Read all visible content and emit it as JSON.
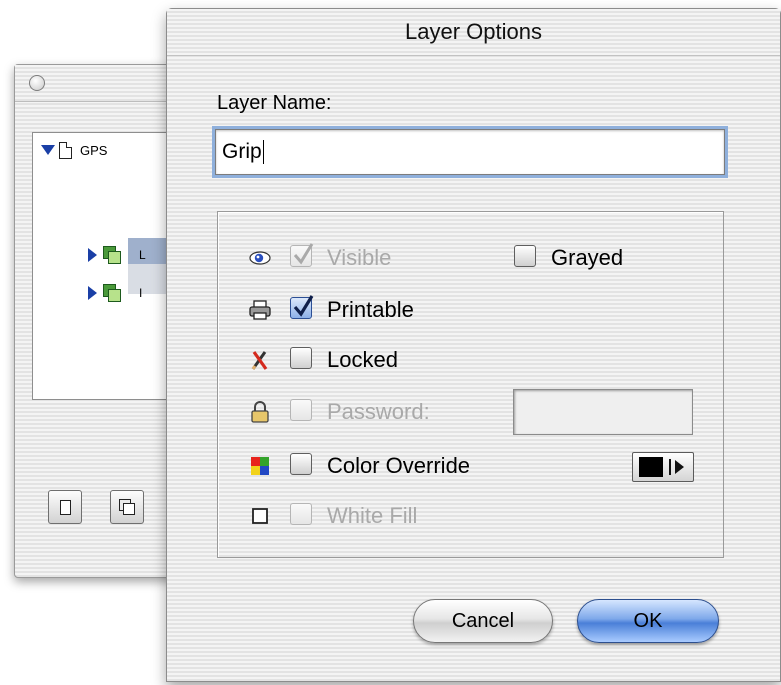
{
  "background_window": {
    "tree": {
      "root": {
        "label": "GPS",
        "expanded": true
      },
      "children": [
        {
          "label": "L",
          "expanded": false,
          "selected": true
        },
        {
          "label": "I",
          "expanded": false,
          "selected": false
        }
      ]
    },
    "buttons": [
      {
        "icon": "new-document-icon"
      },
      {
        "icon": "duplicate-layer-icon"
      }
    ]
  },
  "dialog": {
    "title": "Layer Options",
    "layer_name_label": "Layer Name:",
    "layer_name_value": "Grip",
    "options": {
      "visible": {
        "label": "Visible",
        "checked": true,
        "enabled": false,
        "icon": "eye-icon"
      },
      "grayed": {
        "label": "Grayed",
        "checked": false,
        "enabled": true
      },
      "printable": {
        "label": "Printable",
        "checked": true,
        "enabled": true,
        "icon": "printer-icon"
      },
      "locked": {
        "label": "Locked",
        "checked": false,
        "enabled": true,
        "icon": "crossed-pencil-icon"
      },
      "password": {
        "label": "Password:",
        "checked": false,
        "enabled": false,
        "icon": "padlock-icon",
        "value": ""
      },
      "color_override": {
        "label": "Color Override",
        "checked": false,
        "enabled": true,
        "icon": "color-squares-icon",
        "color": "#000000"
      },
      "white_fill": {
        "label": "White Fill",
        "checked": false,
        "enabled": false,
        "icon": "white-square-icon"
      }
    },
    "buttons": {
      "cancel": "Cancel",
      "ok": "OK"
    }
  }
}
